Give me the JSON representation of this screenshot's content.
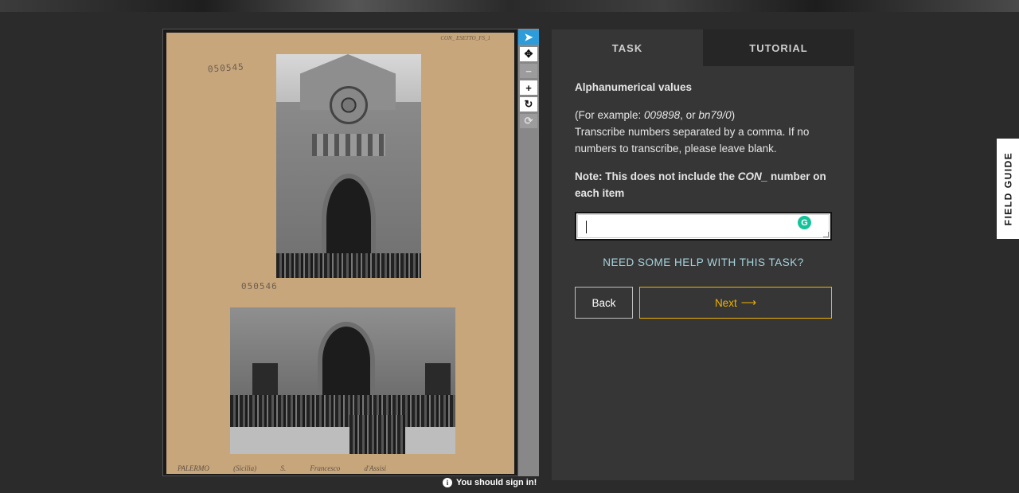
{
  "subject": {
    "corner_note": "CON_ ESETTO_FS_1",
    "stamp_top": "050545",
    "stamp_bottom": "050546",
    "caption": "PALERMO (Sicilia) S. Francesco d'Assisi"
  },
  "toolbar": {
    "tools": [
      {
        "name": "pointer-icon",
        "glyph": "➤",
        "active": true
      },
      {
        "name": "move-icon",
        "glyph": "✥"
      },
      {
        "name": "zoom-out-icon",
        "glyph": "−",
        "disabled": true
      },
      {
        "name": "zoom-in-icon",
        "glyph": "+"
      },
      {
        "name": "rotate-icon",
        "glyph": "↻"
      },
      {
        "name": "reset-icon",
        "glyph": "⟳",
        "disabled": true
      }
    ]
  },
  "signin_notice": "You should sign in!",
  "tabs": {
    "task": "TASK",
    "tutorial": "TUTORIAL"
  },
  "task": {
    "title": "Alphanumerical values",
    "example_prefix": "(For example: ",
    "example_1": "009898",
    "example_sep": ", or ",
    "example_2": "bn79/0",
    "example_suffix": ")",
    "instruction": "Transcribe numbers separated by a comma. If no numbers to transcribe, please leave blank.",
    "note_prefix": "Note: This does not include the ",
    "note_em": "CON_",
    "note_suffix": " number on each item",
    "answer_value": ""
  },
  "help_link": "NEED SOME HELP WITH THIS TASK?",
  "buttons": {
    "back": "Back",
    "next": "Next",
    "next_arrow": "⟶"
  },
  "field_guide": "FIELD GUIDE",
  "colors": {
    "accent": "#f0b200",
    "link": "#a8d4de",
    "active_tool": "#2d9cdb"
  }
}
